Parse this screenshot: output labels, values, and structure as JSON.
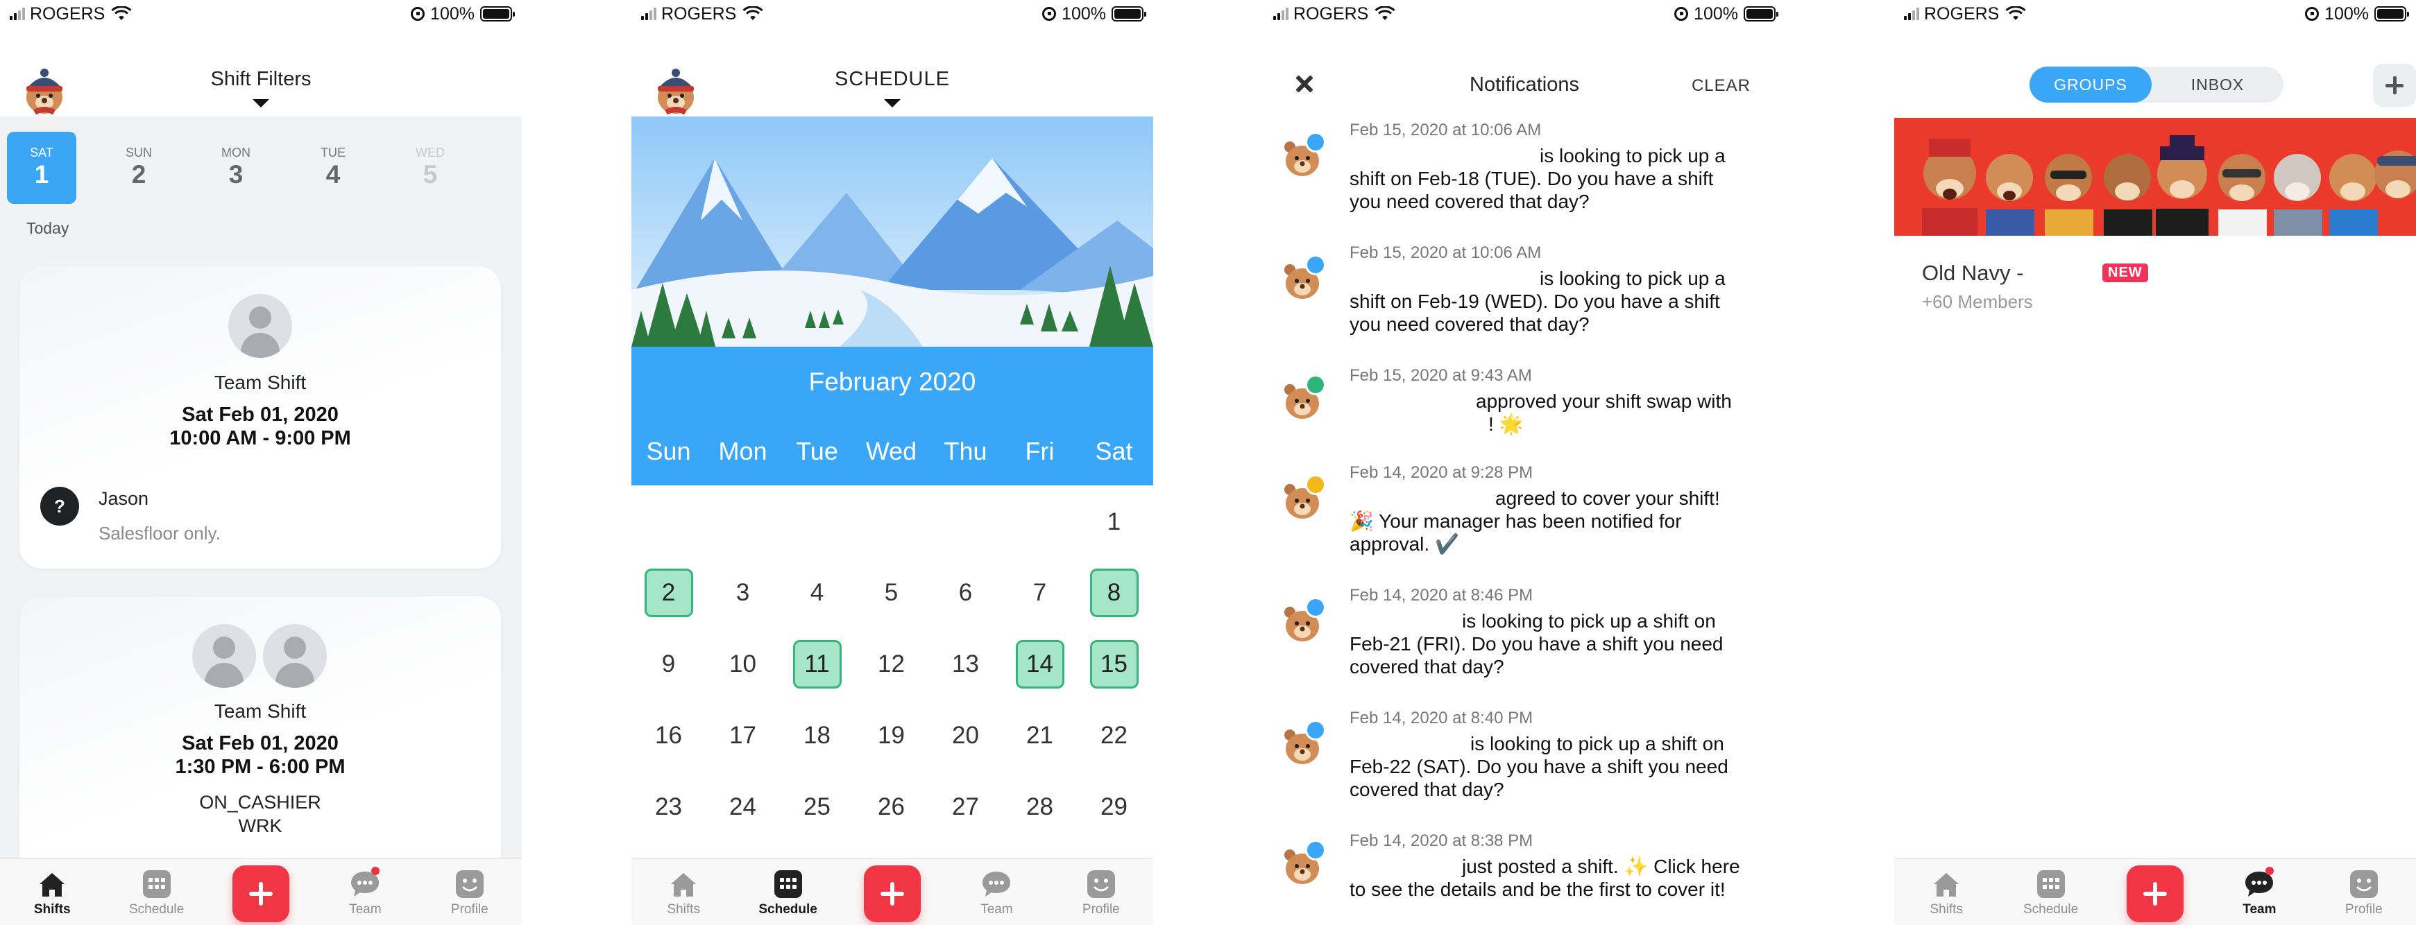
{
  "status_bar": {
    "carrier": "ROGERS",
    "battery": "100%"
  },
  "colors": {
    "accent_blue": "#3aa6f8",
    "add_red": "#f03545",
    "shift_green_fill": "#a5e5c8",
    "shift_green_border": "#34b57d",
    "new_badge": "#f03358"
  },
  "tabs": {
    "shifts": "Shifts",
    "schedule": "Schedule",
    "team": "Team",
    "profile": "Profile"
  },
  "panel1": {
    "title": "Shift Filters",
    "days": [
      {
        "name": "SAT",
        "num": "1"
      },
      {
        "name": "SUN",
        "num": "2"
      },
      {
        "name": "MON",
        "num": "3"
      },
      {
        "name": "TUE",
        "num": "4"
      },
      {
        "name": "WED",
        "num": "5"
      }
    ],
    "today_label": "Today",
    "shifts": [
      {
        "type": "Team Shift",
        "date": "Sat Feb 01, 2020",
        "time": "10:00 AM - 9:00 PM",
        "manager_icon": "?",
        "manager": "Jason",
        "note": "Salesfloor only."
      },
      {
        "type": "Team Shift",
        "date": "Sat Feb 01, 2020",
        "time": "1:30 PM - 6:00 PM",
        "position": "ON_CASHIER",
        "code": "WRK"
      }
    ]
  },
  "panel2": {
    "title": "SCHEDULE",
    "month": "February 2020",
    "weekdays": [
      "Sun",
      "Mon",
      "Tue",
      "Wed",
      "Thu",
      "Fri",
      "Sat"
    ],
    "days": [
      "1",
      "2",
      "3",
      "4",
      "5",
      "6",
      "7",
      "8",
      "9",
      "10",
      "11",
      "12",
      "13",
      "14",
      "15",
      "16",
      "17",
      "18",
      "19",
      "20",
      "21",
      "22",
      "23",
      "24",
      "25",
      "26",
      "27",
      "28",
      "29"
    ],
    "shift_days": [
      "2",
      "8",
      "11",
      "14",
      "15"
    ]
  },
  "panel3": {
    "title": "Notifications",
    "clear_label": "CLEAR",
    "items": [
      {
        "time": "Feb 15, 2020 at 10:06 AM",
        "badge": "chat",
        "line1": "is looking to pick up a",
        "line2": "shift on Feb-18 (TUE). Do you have a shift",
        "line3": "you need covered that day?"
      },
      {
        "time": "Feb 15, 2020 at 10:06 AM",
        "badge": "chat",
        "line1": "is looking to pick up a",
        "line2": "shift on Feb-19 (WED). Do you have a shift",
        "line3": "you need covered that day?"
      },
      {
        "time": "Feb 15, 2020 at 9:43 AM",
        "badge": "check",
        "line1": "approved your shift swap with",
        "line2": "! 🌟",
        "line3": ""
      },
      {
        "time": "Feb 14, 2020 at 9:28 PM",
        "badge": "alert",
        "line1": "agreed to cover your shift!",
        "line2": "🎉 Your manager has been notified for",
        "line3": "approval. ✔️"
      },
      {
        "time": "Feb 14, 2020 at 8:46 PM",
        "badge": "chat",
        "line1": "is looking to pick up a shift on",
        "line2": "Feb-21 (FRI). Do you have a shift you need",
        "line3": "covered that day?"
      },
      {
        "time": "Feb 14, 2020 at 8:40 PM",
        "badge": "chat",
        "line1": "is looking to pick up a shift on",
        "line2": "Feb-22 (SAT). Do you have a shift you need",
        "line3": "covered that day?"
      },
      {
        "time": "Feb 14, 2020 at 8:38 PM",
        "badge": "chat",
        "line1": "just posted a shift. ✨ Click here",
        "line2": "to see the details and be the first to cover it!",
        "line3": ""
      }
    ]
  },
  "panel4": {
    "seg_groups": "GROUPS",
    "seg_inbox": "INBOX",
    "group_name": "Old Navy -",
    "group_badge": "NEW",
    "group_members": "+60 Members"
  }
}
